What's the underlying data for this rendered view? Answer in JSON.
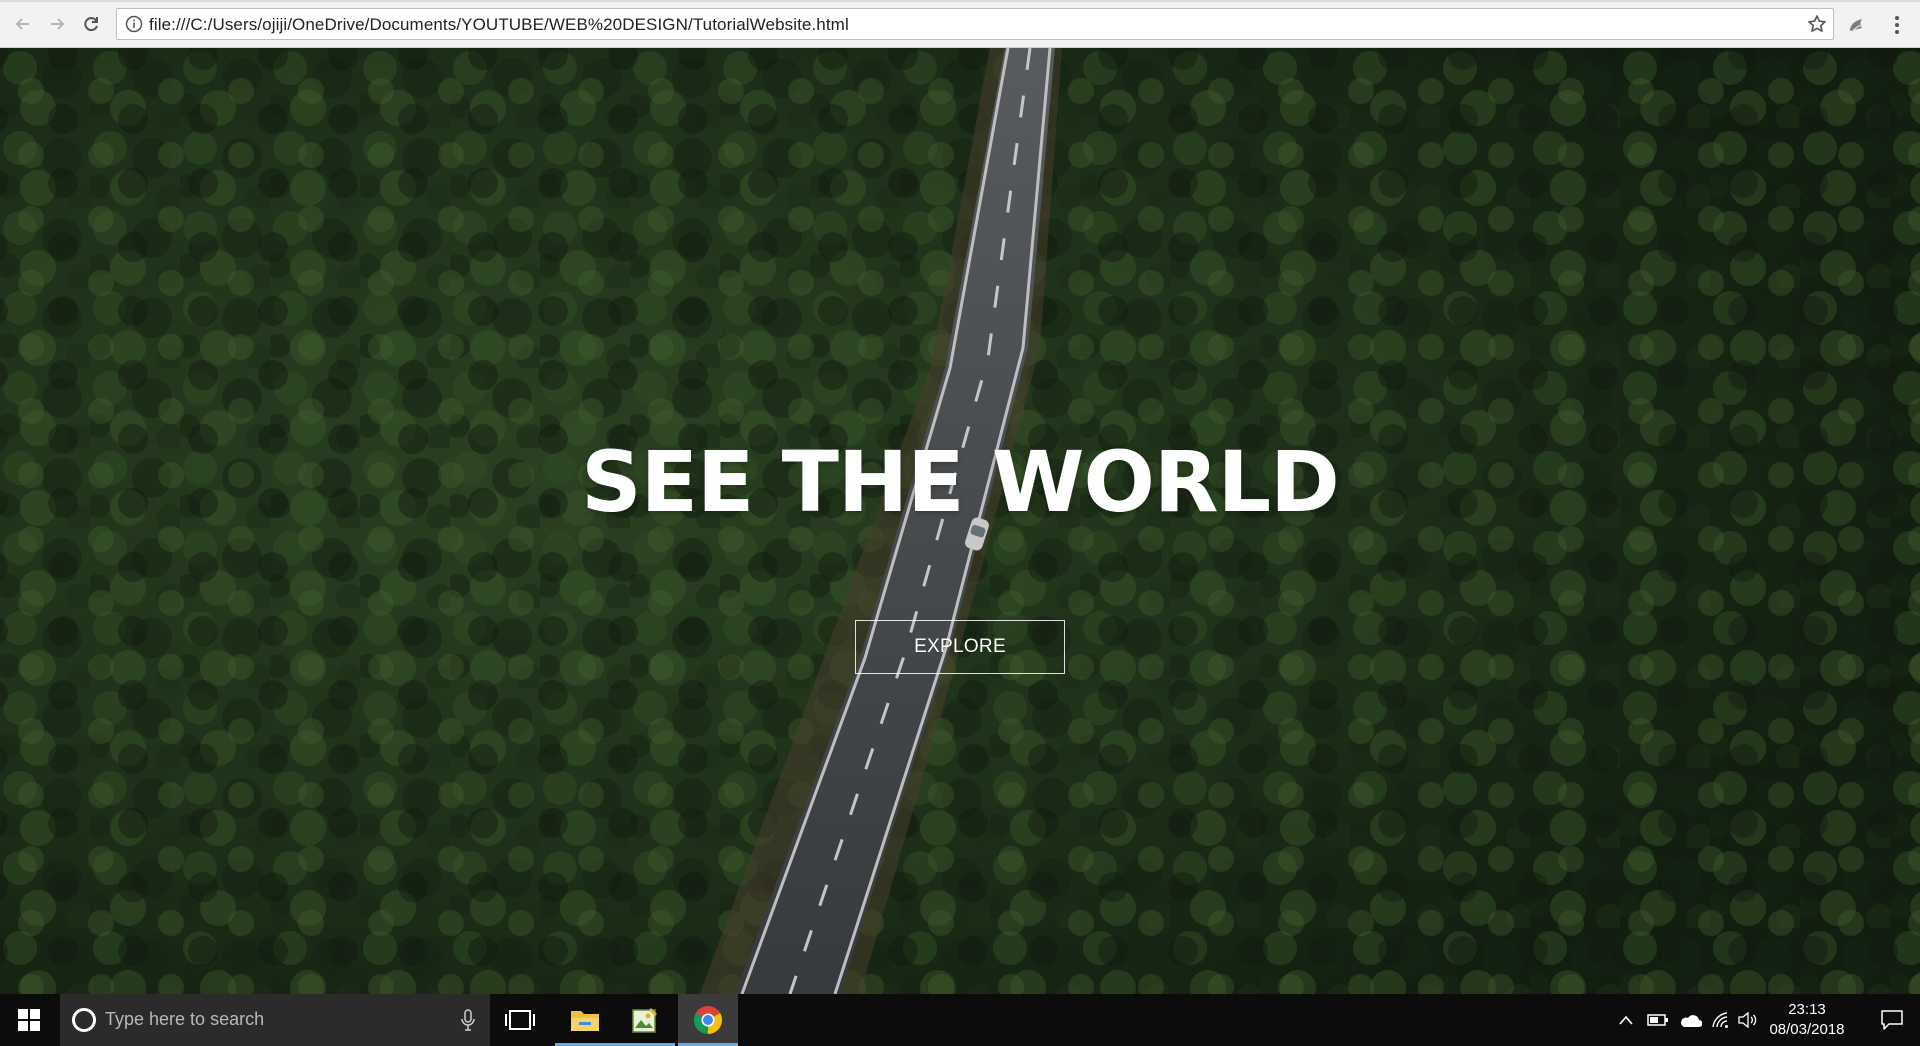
{
  "browser": {
    "url": "file:///C:/Users/ojiji/OneDrive/Documents/YOUTUBE/WEB%20DESIGN/TutorialWebsite.html",
    "back_icon": "arrow-left-icon",
    "forward_icon": "arrow-right-icon",
    "reload_icon": "reload-icon",
    "info_icon": "info-icon",
    "bookmark_icon": "star-icon",
    "extension_icon": "extension-icon",
    "menu_icon": "kebab-menu-icon"
  },
  "hero": {
    "title": "SEE THE WORLD",
    "cta_label": "EXPLORE",
    "background": "aerial view of a road through a dense pine forest with a white car",
    "colors": {
      "forest_dark": "#1b2a18",
      "forest_mid": "#2f4a26",
      "road": "#4a4d50",
      "text": "#ffffff"
    }
  },
  "taskbar": {
    "search_placeholder": "Type here to search",
    "apps": [
      {
        "name": "file-explorer",
        "icon": "folder-icon",
        "active": false
      },
      {
        "name": "paint-app",
        "icon": "image-editor-icon",
        "active": false
      },
      {
        "name": "chrome",
        "icon": "chrome-icon",
        "active": true
      }
    ],
    "time": "23:13",
    "date": "08/03/2018",
    "tray_icons": [
      "chevron-up-icon",
      "battery-icon",
      "onedrive-icon",
      "wifi-icon",
      "volume-icon"
    ],
    "notification_icon": "action-center-icon"
  }
}
